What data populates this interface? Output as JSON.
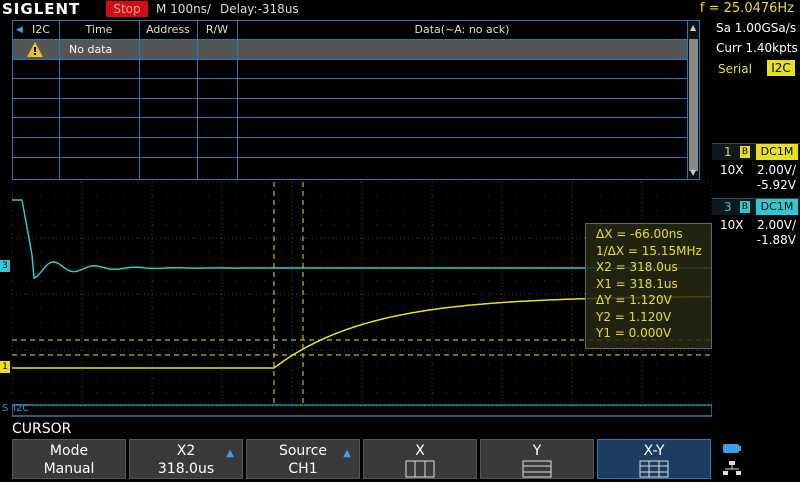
{
  "topbar": {
    "brand": "SIGLENT",
    "run_state": "Stop",
    "timebase": "M 100ns/",
    "delay": "Delay:-318us",
    "frequency": "f = 25.0476Hz"
  },
  "acquisition": {
    "sample_rate": "Sa 1.00GSa/s",
    "memory_depth": "Curr 1.40kpts"
  },
  "decode": {
    "label": "Serial",
    "protocol": "I2C"
  },
  "channels": [
    {
      "number": "1",
      "bw": "B",
      "coupling": "DC1M",
      "probe": "10X",
      "scale": "2.00V/",
      "offset": "-5.92V",
      "color": "#e8e020"
    },
    {
      "number": "3",
      "bw": "B",
      "coupling": "DC1M",
      "probe": "10X",
      "scale": "2.00V/",
      "offset": "-1.88V",
      "color": "#30c8d0"
    }
  ],
  "decode_table": {
    "columns": [
      "I2C",
      "Time",
      "Address",
      "R/W",
      "Data(~A: no ack)"
    ],
    "rows": [
      {
        "icon": "warning-icon",
        "time": "No data",
        "address": "",
        "rw": "",
        "data": ""
      }
    ]
  },
  "cursor_readout": {
    "dx": "ΔX = -66.00ns",
    "inv_dx": "1/ΔX = 15.15MHz",
    "x2": "X2 = 318.0us",
    "x1": "X1 = 318.1us",
    "dy": "ΔY = 1.120V",
    "y2": "Y2 = 1.120V",
    "y1": "Y1 = 0.000V"
  },
  "markers": {
    "ch1": "1",
    "ch3": "3",
    "bus": "I2C",
    "bus_prefix": "S"
  },
  "menu": {
    "title": "CURSOR",
    "softkeys": [
      {
        "line1": "Mode",
        "line2": "Manual",
        "arrow": false
      },
      {
        "line1": "X2",
        "line2": "318.0us",
        "arrow": true
      },
      {
        "line1": "Source",
        "line2": "CH1",
        "arrow": true
      },
      {
        "line1": "X",
        "line2": "",
        "arrow": false
      },
      {
        "line1": "Y",
        "line2": "",
        "arrow": false
      },
      {
        "line1": "X-Y",
        "line2": "",
        "arrow": false
      }
    ]
  },
  "colors": {
    "ch1": "#e8e020",
    "ch3": "#30c8d0",
    "grid": "#4a4a4a",
    "accent": "#2a78b8"
  }
}
